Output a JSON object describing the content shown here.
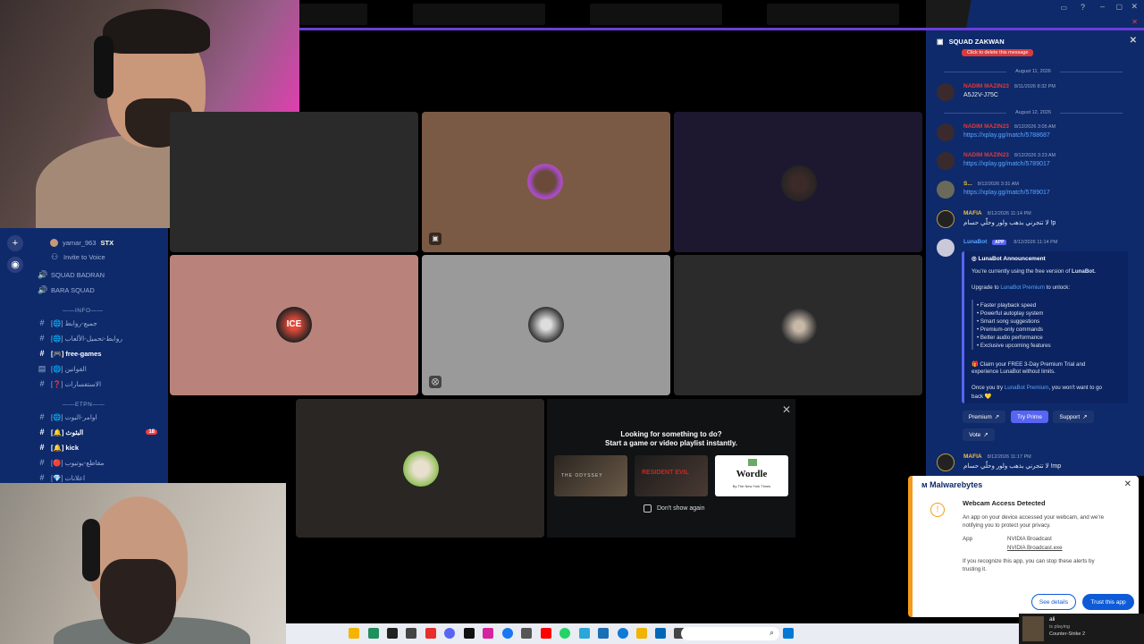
{
  "chat": {
    "channel_name": "SQUAD ZAKWAN",
    "delete_notice": "Click to delete this message",
    "date1": "August 11, 2026",
    "date2": "August 12, 2026",
    "messages": [
      {
        "name": "NADIM MAZIN23",
        "time": "8/11/2026 8:32 PM",
        "text": "A5J2V-J75C",
        "link": false
      },
      {
        "name": "NADIM MAZIN23",
        "time": "8/12/2026 3:05 AM",
        "text": "https://xplay.gg/match/5788687",
        "link": true
      },
      {
        "name": "NADIM MAZIN23",
        "time": "8/12/2026 3:23 AM",
        "text": "https://xplay.gg/match/5789017",
        "link": true
      },
      {
        "name": "S...",
        "time": "8/12/2026 3:31 AM",
        "text": "https://xplay.gg/match/5789017",
        "link": true
      },
      {
        "name": "MAFIA",
        "time": "8/12/2026 11:14 PM",
        "text": "لا تتجرني بذهب ولور وحلّي حسام !p",
        "link": false
      },
      {
        "name": "LunaBot",
        "time": "8/12/2026 11:14 PM",
        "text": "",
        "link": false
      },
      {
        "name": "MAFIA",
        "time": "8/12/2026 11:17 PM",
        "text": "لا تتجرني بذهب ولور وحلّي حسام !mp",
        "link": false
      }
    ],
    "app_badge": "APP"
  },
  "embed": {
    "title": "LunaBot Announcement",
    "line1a": "You're currently using the free version of ",
    "line1b": "LunaBot.",
    "line2a": "Upgrade to ",
    "line2b": "LunaBot Premium",
    "line2c": " to unlock:",
    "features": [
      "• Faster playback speed",
      "• Powerful autoplay system",
      "• Smart song suggestions",
      "• Premium-only commands",
      "• Better audio performance",
      "• Exclusive upcoming features"
    ],
    "claim1": "🎁 Claim your FREE 3-Day Premium Trial and",
    "claim2": "experience LunaBot without limits.",
    "once1a": "Once you try ",
    "once1b": "LunaBot Premium",
    "once1c": ", you won't want to go",
    "once2": "back 💛",
    "buttons": {
      "premium": "Premium",
      "try": "Try Prime",
      "support": "Support",
      "vote": "Vote"
    }
  },
  "sidebar": {
    "voice_user": "yamar_963",
    "voice_user_tag": "STX",
    "invite": "Invite to Voice",
    "voice_channels": [
      "SQUAD BADRAN",
      "BARA SQUAD"
    ],
    "cat_info": "INFO",
    "info_channels": [
      "[🌐] جميع-روابط",
      "[🌐] روابط-تحميل-الألعاب",
      "[🎮] free-games",
      "[🌐] القوانين",
      "[❓] الاستفسارات"
    ],
    "cat_etpn": "ETPN",
    "etpn_channels": [
      "[🌐] اوامر-البوت",
      "[🔔] البثوث",
      "[🔔] kick",
      "[🔴] مقاطع-يوتيوب",
      "[💎] اعلانات"
    ],
    "unread_count": "18"
  },
  "activity": {
    "title1": "Looking for something to do?",
    "title2": "Start a game or video playlist instantly.",
    "cards": [
      "THE ODYSSEY",
      "RESIDENT EVIL",
      "Wordle"
    ],
    "wordle_sub": "By The New York Times",
    "dont_show": "Don't show again"
  },
  "malwarebytes": {
    "logo": "Malwarebytes",
    "heading": "Webcam Access Detected",
    "body1": "An app on your device accessed your webcam, and we're",
    "body2": "notifying you to protect your privacy.",
    "app_label": "App",
    "app_name": "NVIDIA Broadcast",
    "app_file": "NVIDIA Broadcast.exe",
    "note1": "If you recognize this app, you can stop these alerts by",
    "note2": "trusting it.",
    "see_details": "See details",
    "trust": "Trust this app"
  },
  "gamebar": {
    "user": "ali",
    "status": "is playing",
    "game": "Counter-Strike 2"
  },
  "tiles": {
    "ice_label": "ICE"
  },
  "colors": {
    "discord_blue": "#0e2a6b",
    "accent": "#5865f2",
    "mention": "#f23f43",
    "mb_orange": "#f59a1b"
  }
}
